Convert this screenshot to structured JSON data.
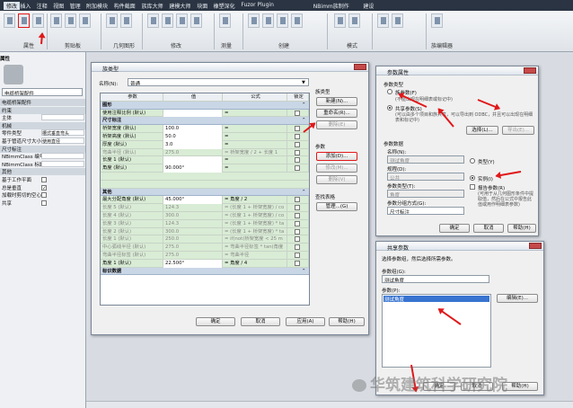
{
  "app": {
    "menu_tabs": [
      "修改",
      "插入",
      "注释",
      "视图",
      "管理",
      "附加模块",
      "构件截面",
      "族库大师",
      "建模大师",
      "块面",
      "橡塑深化",
      "Fuzor Plugin",
      "NBimm族制作",
      "建设"
    ],
    "active_tab": "修改",
    "ribbon_groups": [
      "属性",
      "剪贴板",
      "几何图形",
      "修改",
      "测量",
      "创建",
      "模式",
      "族编辑器"
    ]
  },
  "properties_panel": {
    "title": "属性",
    "type_name": "电缆桥架配件",
    "rows": [
      {
        "label": "电缆桥架配件",
        "value": "",
        "header": true
      },
      {
        "label": "约束",
        "value": "",
        "header": true
      },
      {
        "label": "主体",
        "value": ""
      },
      {
        "label": "机械",
        "value": "",
        "header": true
      },
      {
        "label": "零件类型",
        "value": "槽式垂直弯头"
      },
      {
        "label": "基于管道尺寸大小",
        "value": "使用直径"
      },
      {
        "label": "尺寸标注",
        "value": "",
        "header": true
      },
      {
        "label": "NBimmClass 编号",
        "value": ""
      },
      {
        "label": "NBimmClass 标题",
        "value": ""
      },
      {
        "label": "其他",
        "value": "",
        "header": true
      },
      {
        "label": "基于工作平面",
        "value": "",
        "check": false
      },
      {
        "label": "总是垂直",
        "value": "",
        "check": true
      },
      {
        "label": "加载时剪切的空心",
        "value": "",
        "check": false
      },
      {
        "label": "共享",
        "value": "",
        "check": false
      }
    ]
  },
  "family_types": {
    "title": "族类型",
    "name_label": "名称(N):",
    "name_value": "普通",
    "columns": [
      "参数",
      "值",
      "公式",
      "锁定"
    ],
    "rows": [
      {
        "kind": "group",
        "label": "图形"
      },
      {
        "kind": "data",
        "param": "使用注释比例 (默认)",
        "value": "",
        "formula": "=",
        "lock": ""
      },
      {
        "kind": "group",
        "label": "尺寸标注"
      },
      {
        "kind": "data",
        "param": "桥架宽度 (默认)",
        "value": "100.0",
        "formula": "=",
        "lock": ""
      },
      {
        "kind": "data",
        "param": "桥架高度 (默认)",
        "value": "50.0",
        "formula": "=",
        "lock": ""
      },
      {
        "kind": "data",
        "param": "厚度 (默认)",
        "value": "3.0",
        "formula": "=",
        "lock": ""
      },
      {
        "kind": "data",
        "param": "弯曲半径 (默认)",
        "value": "275.0",
        "formula": "= 桥架宽度 / 2 + 长度 1",
        "lock": "",
        "dim": true
      },
      {
        "kind": "data",
        "param": "长度 1 (默认)",
        "value": "",
        "formula": "=",
        "lock": ""
      },
      {
        "kind": "data",
        "param": "角度 (默认)",
        "value": "90.000°",
        "formula": "=",
        "lock": ""
      },
      {
        "kind": "blank"
      },
      {
        "kind": "blank"
      },
      {
        "kind": "group",
        "label": "其他"
      },
      {
        "kind": "data",
        "param": "最大分配角度 (默认)",
        "value": "45.000°",
        "formula": "= 角度 / 2",
        "lock": ""
      },
      {
        "kind": "data",
        "param": "长度 5 (默认)",
        "value": "124.3",
        "formula": "= (长度 1 + 桥架宽度) / co",
        "lock": "",
        "dim": true
      },
      {
        "kind": "data",
        "param": "长度 4 (默认)",
        "value": "300.0",
        "formula": "= (长度 1 + 桥架宽度) / co",
        "lock": "",
        "dim": true
      },
      {
        "kind": "data",
        "param": "长度 3 (默认)",
        "value": "124.3",
        "formula": "= (长度 1 + 桥架宽度) * ta",
        "lock": "",
        "dim": true
      },
      {
        "kind": "data",
        "param": "长度 2 (默认)",
        "value": "300.0",
        "formula": "= (长度 1 + 桥架宽度) * ta",
        "lock": "",
        "dim": true
      },
      {
        "kind": "data",
        "param": "长度 1 (默认)",
        "value": "250.0",
        "formula": "= if(not(桥架宽度 < 25 m",
        "lock": "",
        "dim": true
      },
      {
        "kind": "data",
        "param": "中心弧线半径 (默认)",
        "value": "275.0",
        "formula": "= 弯曲半径标签 * tan(角度",
        "lock": "",
        "dim": true
      },
      {
        "kind": "data",
        "param": "弯曲半径标签 (默认)",
        "value": "275.0",
        "formula": "= 弯曲半径",
        "lock": "",
        "dim": true
      },
      {
        "kind": "data",
        "param": "角度 1 (默认)",
        "value": "22.500°",
        "formula": "= 角度 / 4",
        "lock": ""
      },
      {
        "kind": "group",
        "label": "标识数据"
      }
    ],
    "side": {
      "types_heading": "族类型",
      "new_btn": "新建(N)...",
      "rename_btn": "重命名(R)...",
      "delete_btn": "删除(E)",
      "params_heading": "参数",
      "add_btn": "添加(D)...",
      "modify_btn": "修改(M)...",
      "remove_btn": "删除(V)",
      "lookup_heading": "查找表格",
      "manage_btn": "管理...(G)"
    },
    "ok": "确定",
    "cancel": "取消",
    "apply": "应用(A)",
    "help": "帮助(H)"
  },
  "param_props": {
    "title": "参数属性",
    "param_type": "参数类型",
    "family_param": "族参数(F)",
    "family_param_desc": "(不能出现在明细表或标记中)",
    "shared_param": "共享参数(S)",
    "shared_param_desc": "(可以由多个项目和族共享，可以导出到 ODBC，并且可以出现在明细表和标记中)",
    "select_btn": "选择(L)...",
    "export_btn": "导出(E)...",
    "param_data": "参数数据",
    "name_label": "名称(N):",
    "name_value": "测试角度",
    "type_radio": "类型(Y)",
    "discipline_label": "规程(D):",
    "discipline_value": "公共",
    "instance_radio": "实例(I)",
    "param_type_label": "参数类型(T):",
    "param_type_value": "角度",
    "report_param": "报告参数(R)",
    "report_desc": "(可用于从几何图形条件中提取值，然后在公式中报告此值或用作明细表参数)",
    "group_label": "参数分组方式(G):",
    "group_value": "尺寸标注",
    "ok": "确定",
    "cancel": "取消",
    "help": "帮助(H)"
  },
  "shared_params": {
    "title": "共享参数",
    "prompt": "选择参数组，然后选择所需参数。",
    "group_label": "参数组(G):",
    "group_value": "测试角度",
    "params_label": "参数(P):",
    "items": [
      "测试角度"
    ],
    "edit_btn": "编辑(E)...",
    "ok": "确定",
    "cancel": "取消",
    "help": "帮助(H)"
  },
  "watermark": "华筑建筑科学研究院",
  "colors": {
    "accent_red": "#e0181a",
    "table_green": "#d9ecd5",
    "group_blue": "#c9d6e6"
  }
}
